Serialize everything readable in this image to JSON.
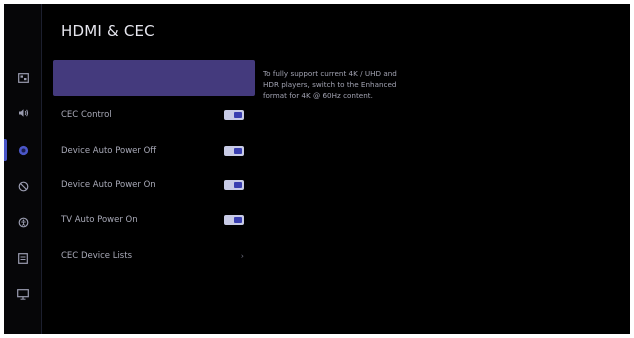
{
  "page": {
    "title": "HDMI & CEC"
  },
  "side_rail": {
    "items": [
      {
        "icon": "picture-icon"
      },
      {
        "icon": "sound-icon"
      },
      {
        "icon": "channel-icon",
        "active": true
      },
      {
        "icon": "network-icon"
      },
      {
        "icon": "accessibility-icon"
      },
      {
        "icon": "system-icon"
      },
      {
        "icon": "support-icon"
      }
    ]
  },
  "menu": {
    "items": [
      {
        "label": "",
        "value": ""
      },
      {
        "label": "CEC Control",
        "toggle": "on"
      },
      {
        "label": "Device Auto Power Off",
        "toggle": "on"
      },
      {
        "label": "Device Auto Power On",
        "toggle": "on"
      },
      {
        "label": "TV Auto Power On",
        "toggle": "on"
      },
      {
        "label": "CEC Device Lists",
        "chevron": "›"
      }
    ]
  },
  "description": {
    "text": "To fully support current 4K / UHD and HDR players, switch to the Enhanced format for 4K @ 60Hz content."
  },
  "colors": {
    "background": "#000000",
    "selected": "#443a7d",
    "toggle_track": "#c8cbe6",
    "toggle_knob": "#3a3fb0",
    "rail_accent": "#4a56c8"
  }
}
